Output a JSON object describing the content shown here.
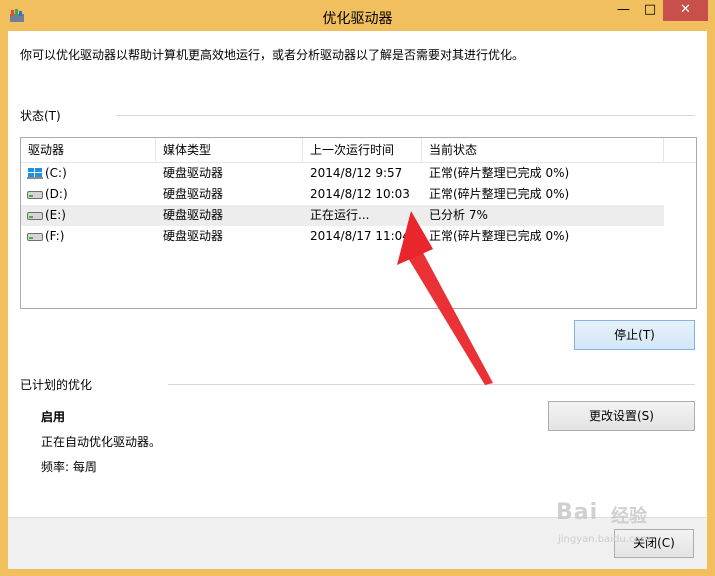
{
  "window": {
    "title": "优化驱动器",
    "minimize_glyph": "—",
    "maximize_glyph": "□",
    "close_glyph": "✕"
  },
  "description": "你可以优化驱动器以帮助计算机更高效地运行，或者分析驱动器以了解是否需要对其进行优化。",
  "status": {
    "label": "状态(T)",
    "columns": [
      "驱动器",
      "媒体类型",
      "上一次运行时间",
      "当前状态"
    ],
    "rows": [
      {
        "drive": "(C:)",
        "media": "硬盘驱动器",
        "last_run": "2014/8/12 9:57",
        "state": "正常(碎片整理已完成 0%)",
        "icon": "windows-drive-icon"
      },
      {
        "drive": "(D:)",
        "media": "硬盘驱动器",
        "last_run": "2014/8/12 10:03",
        "state": "正常(碎片整理已完成 0%)",
        "icon": "hard-drive-icon"
      },
      {
        "drive": "(E:)",
        "media": "硬盘驱动器",
        "last_run": "正在运行...",
        "state": "已分析 7%",
        "icon": "hard-drive-icon"
      },
      {
        "drive": "(F:)",
        "media": "硬盘驱动器",
        "last_run": "2014/8/17 11:04",
        "state": "正常(碎片整理已完成 0%)",
        "icon": "hard-drive-icon"
      }
    ],
    "stop_button": "停止(T)"
  },
  "scheduled": {
    "label": "已计划的优化",
    "state_title": "启用",
    "state_desc": "正在自动优化驱动器。",
    "frequency": "频率: 每周",
    "change_button": "更改设置(S)"
  },
  "close_button": "关闭(C)",
  "watermark": {
    "brand": "Bai",
    "sub": "经验",
    "url": "jingyan.baidu.com"
  },
  "colors": {
    "frame": "#f2bf5e",
    "close_button": "#c7504a",
    "selected_row": "#ededed",
    "annotation_arrow": "#e8262b"
  }
}
